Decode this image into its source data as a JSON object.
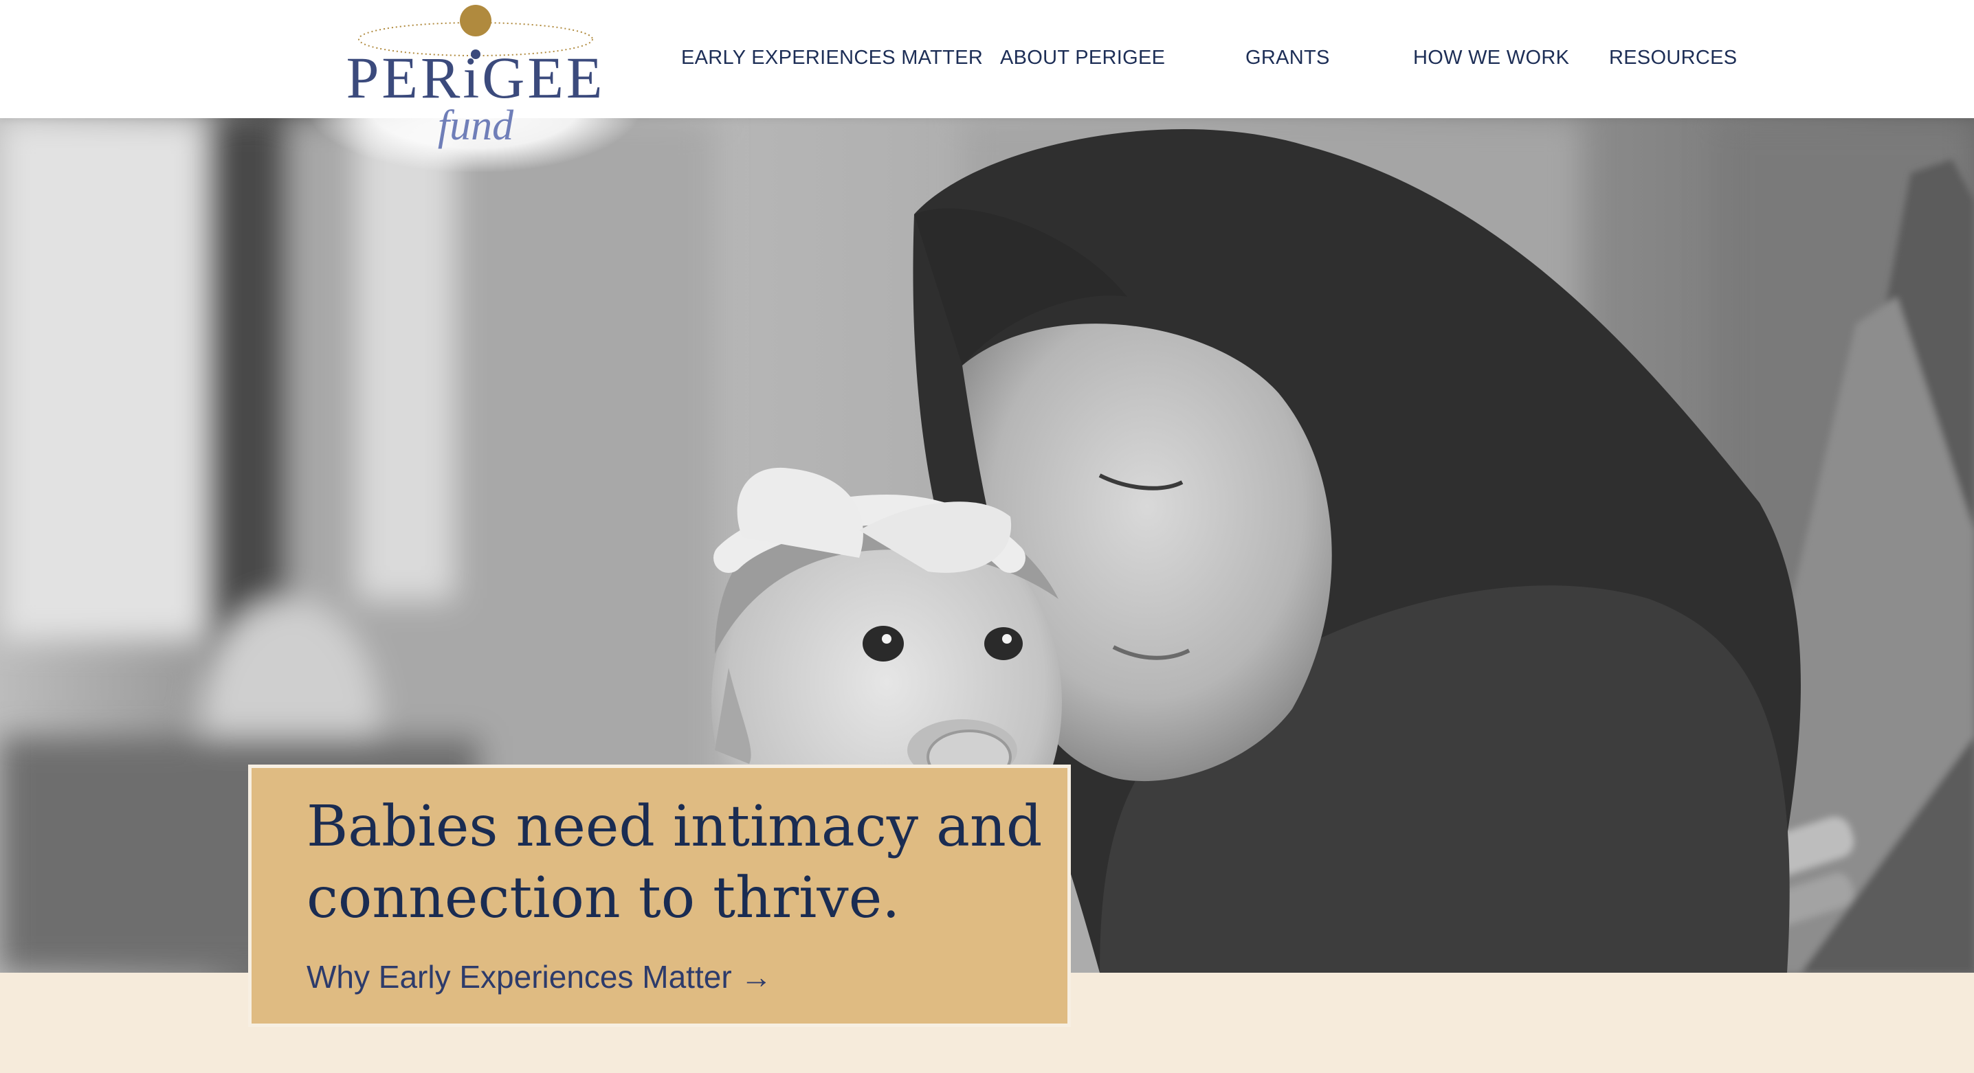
{
  "header": {
    "logo": {
      "name": "PERiGEE",
      "tagline": "fund"
    },
    "nav": [
      {
        "label": "EARLY EXPERIENCES MATTER"
      },
      {
        "label": "ABOUT PERIGEE"
      },
      {
        "label": "GRANTS"
      },
      {
        "label": "HOW WE WORK"
      },
      {
        "label": "RESOURCES"
      }
    ]
  },
  "hero": {
    "photo": "mother-holding-baby-photo",
    "tone": "grayscale"
  },
  "callout": {
    "headline": "Babies need intimacy and connection to thrive.",
    "link_label": "Why Early Experiences Matter →"
  },
  "colors": {
    "navy": "#1d2e56",
    "logo_blue": "#3b4a7c",
    "gold": "#b08a3e",
    "callout_bg": "#dfbb82",
    "page_bg": "#f6ebdb"
  }
}
